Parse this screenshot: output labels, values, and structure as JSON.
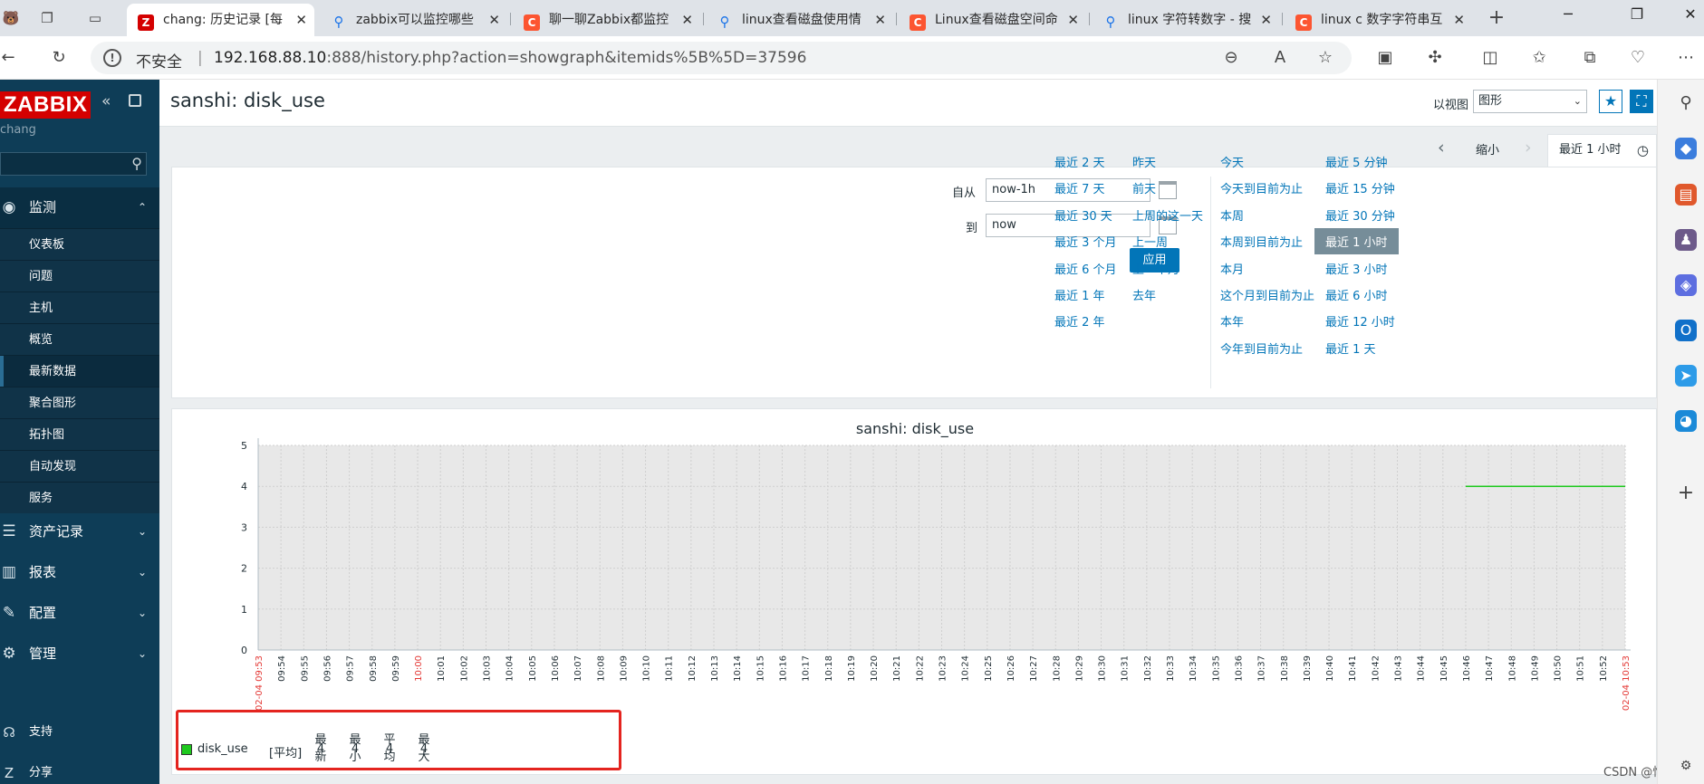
{
  "browser": {
    "tabs": [
      {
        "title": "chang: 历史记录 [每",
        "favicon": "Z",
        "kind": "zabbix",
        "active": true
      },
      {
        "title": "zabbix可以监控哪些",
        "favicon": "search",
        "kind": "search",
        "active": false
      },
      {
        "title": "聊一聊Zabbix都监控",
        "favicon": "C",
        "kind": "csdn",
        "active": false
      },
      {
        "title": "linux查看磁盘使用情",
        "favicon": "search",
        "kind": "search",
        "active": false
      },
      {
        "title": "Linux查看磁盘空间命",
        "favicon": "C",
        "kind": "csdn",
        "active": false
      },
      {
        "title": "linux 字符转数字 - 搜",
        "favicon": "search",
        "kind": "search",
        "active": false
      },
      {
        "title": "linux c 数字字符串互",
        "favicon": "C",
        "kind": "csdn",
        "active": false
      }
    ],
    "new_tab": "+",
    "security_label": "不安全",
    "url_host": "192.168.88.10",
    "url_rest": ":888/history.php?action=showgraph&itemids%5B%5D=37596"
  },
  "sidebar": {
    "logo": "ZABBIX",
    "user": "chang",
    "menu": [
      {
        "label": "监测",
        "icon": "eye-icon",
        "open": true
      },
      {
        "label": "资产记录",
        "icon": "list-icon",
        "open": false
      },
      {
        "label": "报表",
        "icon": "report-icon",
        "open": false
      },
      {
        "label": "配置",
        "icon": "wrench-icon",
        "open": false
      },
      {
        "label": "管理",
        "icon": "gear-icon",
        "open": false
      }
    ],
    "submenu": [
      "仪表板",
      "问题",
      "主机",
      "概览",
      "最新数据",
      "聚合图形",
      "拓扑图",
      "自动发现",
      "服务"
    ],
    "selected_submenu": "最新数据",
    "bottom": [
      {
        "label": "支持",
        "icon": "headset-icon"
      },
      {
        "label": "分享",
        "icon": "share-icon"
      }
    ]
  },
  "header": {
    "title": "sanshi: disk_use",
    "view_label": "以视图",
    "view_value": "图形"
  },
  "filter": {
    "zoom_out": "缩小",
    "active_tab": "最近 1 小时",
    "from_label": "自从",
    "from_value": "now-1h",
    "to_label": "到",
    "to_value": "now",
    "apply": "应用",
    "quick_ranges": [
      [
        "最近 2 天",
        "最近 7 天",
        "最近 30 天",
        "最近 3 个月",
        "最近 6 个月",
        "最近 1 年",
        "最近 2 年"
      ],
      [
        "昨天",
        "前天",
        "上周的这一天",
        "上一周",
        "上一个月",
        "去年"
      ],
      [
        "今天",
        "今天到目前为止",
        "本周",
        "本周到目前为止",
        "本月",
        "这个月到目前为止",
        "本年",
        "今年到目前为止"
      ],
      [
        "最近 5 分钟",
        "最近 15 分钟",
        "最近 30 分钟",
        "最近 1 小时",
        "最近 3 小时",
        "最近 6 小时",
        "最近 12 小时",
        "最近 1 天"
      ]
    ],
    "selected_range": "最近 1 小时"
  },
  "chart_data": {
    "type": "line",
    "title": "sanshi: disk_use",
    "ylim": [
      0,
      5
    ],
    "yticks": [
      0,
      1,
      2,
      3,
      4,
      5
    ],
    "x_start_label": "02-04 09:53",
    "x_end_label": "02-04 10:53",
    "x_tick_labels": [
      "09:54",
      "09:55",
      "09:56",
      "09:57",
      "09:58",
      "09:59",
      "10:00",
      "10:01",
      "10:02",
      "10:03",
      "10:04",
      "10:05",
      "10:06",
      "10:07",
      "10:08",
      "10:09",
      "10:10",
      "10:11",
      "10:12",
      "10:13",
      "10:14",
      "10:15",
      "10:16",
      "10:17",
      "10:18",
      "10:19",
      "10:20",
      "10:21",
      "10:22",
      "10:23",
      "10:24",
      "10:25",
      "10:26",
      "10:27",
      "10:28",
      "10:29",
      "10:30",
      "10:31",
      "10:32",
      "10:33",
      "10:34",
      "10:35",
      "10:36",
      "10:37",
      "10:38",
      "10:39",
      "10:40",
      "10:41",
      "10:42",
      "10:43",
      "10:44",
      "10:45",
      "10:46",
      "10:47",
      "10:48",
      "10:49",
      "10:50",
      "10:51",
      "10:52"
    ],
    "highlight_tick": "10:00",
    "series": [
      {
        "name": "disk_use",
        "color": "#1ec91e",
        "x": [
          "10:46",
          "10:53"
        ],
        "values": [
          4,
          4
        ]
      }
    ],
    "legend": {
      "name": "disk_use",
      "aggregate": "[平均]",
      "columns": [
        "最新",
        "最小",
        "平均",
        "最大"
      ],
      "values": [
        "4",
        "4",
        "4",
        "4"
      ]
    },
    "grid": true
  },
  "watermark": "CSDN @怡雪"
}
